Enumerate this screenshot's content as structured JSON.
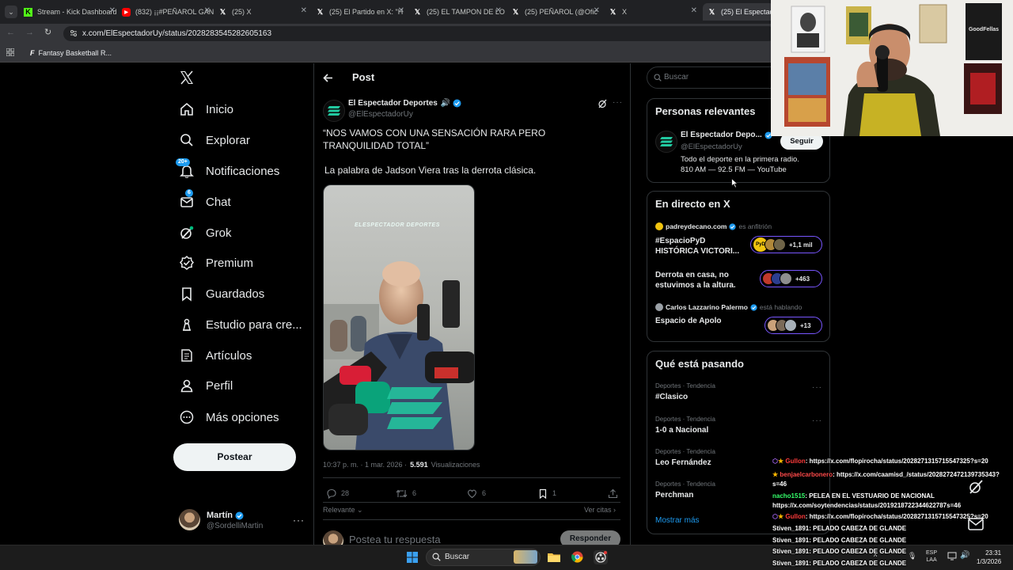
{
  "browser": {
    "tabs": [
      {
        "title": "Stream - Kick Dashboard",
        "icon": "kick-icon"
      },
      {
        "title": "(832) ¡¡#PEÑAROL GANÓ",
        "icon": "youtube-icon"
      },
      {
        "title": "(25) X",
        "icon": "x-icon"
      },
      {
        "title": "(25) El Partido en X: \"H",
        "icon": "x-icon"
      },
      {
        "title": "(25) EL TAMPON DE LO",
        "icon": "x-icon"
      },
      {
        "title": "(25) PEÑAROL (@Ofic",
        "icon": "x-icon"
      },
      {
        "title": "X",
        "icon": "x-icon"
      },
      {
        "title": "(25) El Espectador",
        "icon": "x-icon"
      }
    ],
    "url": "x.com/ElEspectadorUy/status/2028283545282605163",
    "bookmark": "Fantasy Basketball R..."
  },
  "nav": {
    "items": [
      {
        "label": "Inicio",
        "icon": "home-icon"
      },
      {
        "label": "Explorar",
        "icon": "search-icon"
      },
      {
        "label": "Notificaciones",
        "icon": "bell-icon",
        "badge": "20+"
      },
      {
        "label": "Chat",
        "icon": "mail-icon",
        "badge": "6"
      },
      {
        "label": "Grok",
        "icon": "grok-icon"
      },
      {
        "label": "Premium",
        "icon": "premium-icon"
      },
      {
        "label": "Guardados",
        "icon": "bookmark-icon"
      },
      {
        "label": "Estudio para cre...",
        "icon": "studio-icon"
      },
      {
        "label": "Artículos",
        "icon": "article-icon"
      },
      {
        "label": "Perfil",
        "icon": "person-icon"
      },
      {
        "label": "Más opciones",
        "icon": "more-circle-icon"
      }
    ],
    "post_button": "Postear",
    "account": {
      "name": "Martín",
      "handle": "@SordelliMartin"
    }
  },
  "post": {
    "header": "Post",
    "author_name": "El Espectador Deportes",
    "author_handle": "@ElEspectadorUy",
    "text": "“NOS VAMOS CON UNA SENSACIÓN RARA PERO TRANQUILIDAD TOTAL”",
    "subtext": "La palabra de Jadson Viera tras la derrota clásica.",
    "time": "10:37 p. m. · 1 mar. 2026 ·",
    "views": "5.591",
    "views_label": "Visualizaciones",
    "replies": "28",
    "reposts": "6",
    "likes": "6",
    "bookmarks": "1",
    "sort": "Relevante",
    "quotes": "Ver citas",
    "reply_placeholder": "Postea tu respuesta",
    "reply_button": "Responder",
    "media_watermark": "ELESPECTADOR DEPORTES"
  },
  "sidebar": {
    "search_placeholder": "Buscar",
    "relevant": {
      "title": "Personas relevantes",
      "name": "El Espectador Depo...",
      "handle": "@ElEspectadorUy",
      "bio": "Todo el deporte en la primera radio. 810 AM — 92.5 FM — YouTube",
      "follow": "Seguir"
    },
    "live": {
      "title": "En directo en X",
      "spaces": [
        {
          "host": "padreydecano.com",
          "role": "es anfitrión",
          "title": "#EspacioPyD HISTÓRICA VICTORI...",
          "count": "+1,1 mil"
        },
        {
          "host": "",
          "role": "",
          "title": "Derrota en casa, no estuvimos a la altura.",
          "count": "+463"
        },
        {
          "host": "Carlos Lazzarino Palermo",
          "role": "está hablando",
          "title": "Espacio de Apolo",
          "count": "+13"
        }
      ]
    },
    "trending": {
      "title": "Qué está pasando",
      "items": [
        {
          "category": "Deportes · Tendencia",
          "name": "#Clasico"
        },
        {
          "category": "Deportes · Tendencia",
          "name": "1-0 a Nacional"
        },
        {
          "category": "Deportes · Tendencia",
          "name": "Leo Fernández"
        },
        {
          "category": "Deportes · Tendencia",
          "name": "Perchman"
        }
      ],
      "more": "Mostrar más"
    }
  },
  "chat": [
    {
      "user": "Gullon",
      "color": "#ff3b3b",
      "text": ": https://x.com/flopirocha/status/2028271315715547325?s=20"
    },
    {
      "user": "benjaelcarbonero",
      "color": "#ff4a4a",
      "text": ": https://x.com/caamisd_/status/2028272472139735343?s=46"
    },
    {
      "user": "nacho1515",
      "color": "#35ff6b",
      "text": ": PELEA EN EL VESTUARIO DE NACIONAL https://x.com/soytendencias/status/2019218722344622787s=46"
    },
    {
      "user": "Gullon",
      "color": "#ff3b3b",
      "text": ": https://x.com/flopirocha/status/2028271315715547325?s=20"
    },
    {
      "user": "Stiven_1891",
      "color": "#ffffff",
      "text": ": PELADO CABEZA DE GLANDE"
    },
    {
      "user": "Stiven_1891",
      "color": "#ffffff",
      "text": ": PELADO CABEZA DE GLANDE"
    },
    {
      "user": "Stiven_1891",
      "color": "#ffffff",
      "text": ": PELADO CABEZA DE GLANDE"
    },
    {
      "user": "Stiven_1891",
      "color": "#ffffff",
      "text": ": PELADO CABEZA DE GLANDE"
    }
  ],
  "webcam": {
    "poster_text": "GoodFellas"
  },
  "taskbar": {
    "search": "Buscar",
    "lang": "ESP",
    "lang2": "LAA",
    "time": "23:31",
    "date": "1/3/2026"
  },
  "colors": {
    "accent": "#1d9bf0",
    "spaces": "#7856ff",
    "brand_green": "#22c9a0"
  }
}
